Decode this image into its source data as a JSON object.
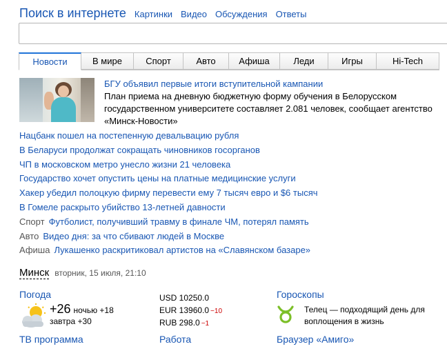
{
  "search": {
    "title": "Поиск в интернете",
    "links": [
      "Картинки",
      "Видео",
      "Обсуждения",
      "Ответы"
    ],
    "query": ""
  },
  "tabs": [
    {
      "label": "Новости",
      "active": true
    },
    {
      "label": "В мире",
      "active": false
    },
    {
      "label": "Спорт",
      "active": false
    },
    {
      "label": "Авто",
      "active": false
    },
    {
      "label": "Афиша",
      "active": false
    },
    {
      "label": "Леди",
      "active": false
    },
    {
      "label": "Игры",
      "active": false
    },
    {
      "label": "Hi-Tech",
      "active": false
    }
  ],
  "lead": {
    "headline": "БГУ объявил первые итоги вступительной кампании",
    "body": "План приема на дневную бюджетную форму обучения в Белорусском государственном университете составляет 2.081 человек, сообщает агентство «Минск-Новости»"
  },
  "news": [
    {
      "category": "",
      "title": "Нацбанк пошел на постепенную девальвацию рубля"
    },
    {
      "category": "",
      "title": "В Беларуси продолжат сокращать чиновников госорганов"
    },
    {
      "category": "",
      "title": "ЧП в московском метро унесло жизни 21 человека"
    },
    {
      "category": "",
      "title": "Государство хочет опустить цены на платные медицинские услуги"
    },
    {
      "category": "",
      "title": "Хакер убедил полоцкую фирму перевести ему 7 тысяч евро и $6 тысяч"
    },
    {
      "category": "",
      "title": "В Гомеле раскрыто убийство 13-летней давности"
    },
    {
      "category": "Спорт",
      "title": "Футболист, получивший травму в финале ЧМ, потерял память"
    },
    {
      "category": "Авто",
      "title": "Видео дня: за что сбивают людей в Москве"
    },
    {
      "category": "Афиша",
      "title": "Лукашенко раскритиковал артистов на «Славянском базаре»"
    }
  ],
  "location": {
    "city": "Минск",
    "datetime": "вторник, 15 июля, 21:10"
  },
  "weather": {
    "header": "Погода",
    "icon": "partly-cloudy-icon",
    "now": "+26",
    "night_label": "ночью +18",
    "tomorrow_label": "завтра +30"
  },
  "rates": [
    {
      "label": "USD 10250.0",
      "delta": ""
    },
    {
      "label": "EUR 13960.0",
      "delta": "−10"
    },
    {
      "label": "RUB 298.0",
      "delta": "−1"
    }
  ],
  "horoscope": {
    "header": "Гороскопы",
    "icon": "taurus-icon",
    "text": "Телец — подходящий день для воплощения в жизнь"
  },
  "bottom_links": {
    "tv": "ТВ программа",
    "jobs": "Работа",
    "browser": "Браузер «Амиго»"
  },
  "colors": {
    "link": "#1856b3",
    "accent": "#1e73d8",
    "rate_down": "#cc0000",
    "horoscope_icon": "#7cbf28"
  }
}
